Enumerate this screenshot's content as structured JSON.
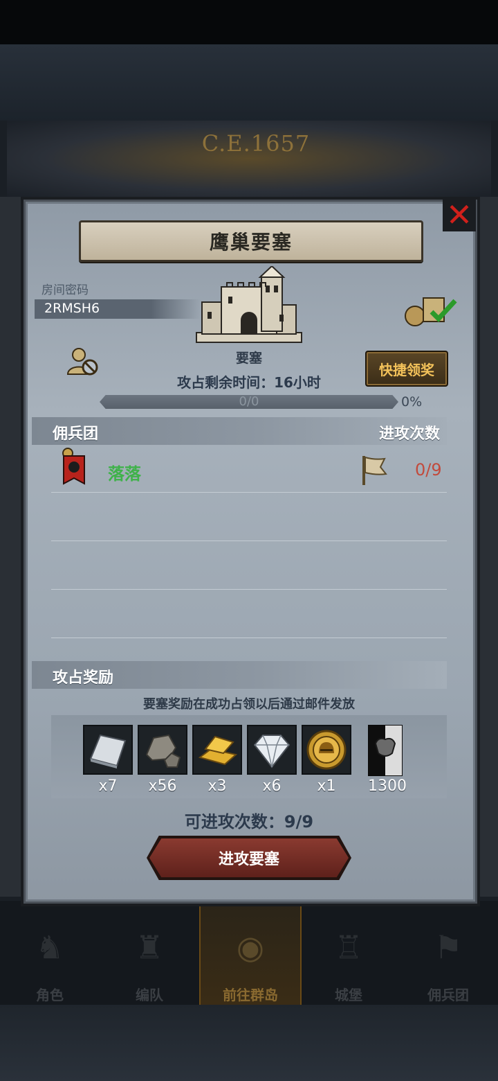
{
  "background": {
    "world_year": "C.E.1657"
  },
  "dialog": {
    "title": "鹰巢要塞",
    "room_code_label": "房间密码",
    "room_code": "2RMSH6",
    "fortress_label": "要塞",
    "claim_button": "快捷领奖",
    "time_left": "攻占剩余时间：16小时",
    "progress": {
      "text": "0/0",
      "percent_label": "0%",
      "value": 0
    },
    "mercenary_section": {
      "title": "佣兵团",
      "attack_count_header": "进攻次数",
      "members": [
        {
          "name": "落落",
          "attacks": "0/9"
        }
      ]
    },
    "reward_section": {
      "title": "攻占奖励",
      "note": "要塞奖励在成功占领以后通过邮件发放",
      "items": [
        {
          "icon": "silver-ingot-icon",
          "qty": "x7"
        },
        {
          "icon": "stone-ore-icon",
          "qty": "x56"
        },
        {
          "icon": "gold-bars-icon",
          "qty": "x3"
        },
        {
          "icon": "diamond-icon",
          "qty": "x6"
        },
        {
          "icon": "knight-medal-icon",
          "qty": "x1"
        }
      ],
      "honor": {
        "icon": "bull-emblem-icon",
        "qty": "1300"
      }
    },
    "attempts": "可进攻次数：9/9",
    "attack_button": "进攻要塞"
  },
  "bottom_nav": [
    {
      "label": "角色",
      "icon": "character-icon"
    },
    {
      "label": "编队",
      "icon": "formation-icon"
    },
    {
      "label": "前往群岛",
      "icon": "islands-icon",
      "active": true
    },
    {
      "label": "城堡",
      "icon": "castle-icon"
    },
    {
      "label": "佣兵团",
      "icon": "mercenary-icon"
    }
  ],
  "colors": {
    "member_name": "#3fb24a",
    "attack_count": "#c24a3c",
    "claim_text": "#f3c25a",
    "close_x": "#d0201b"
  }
}
